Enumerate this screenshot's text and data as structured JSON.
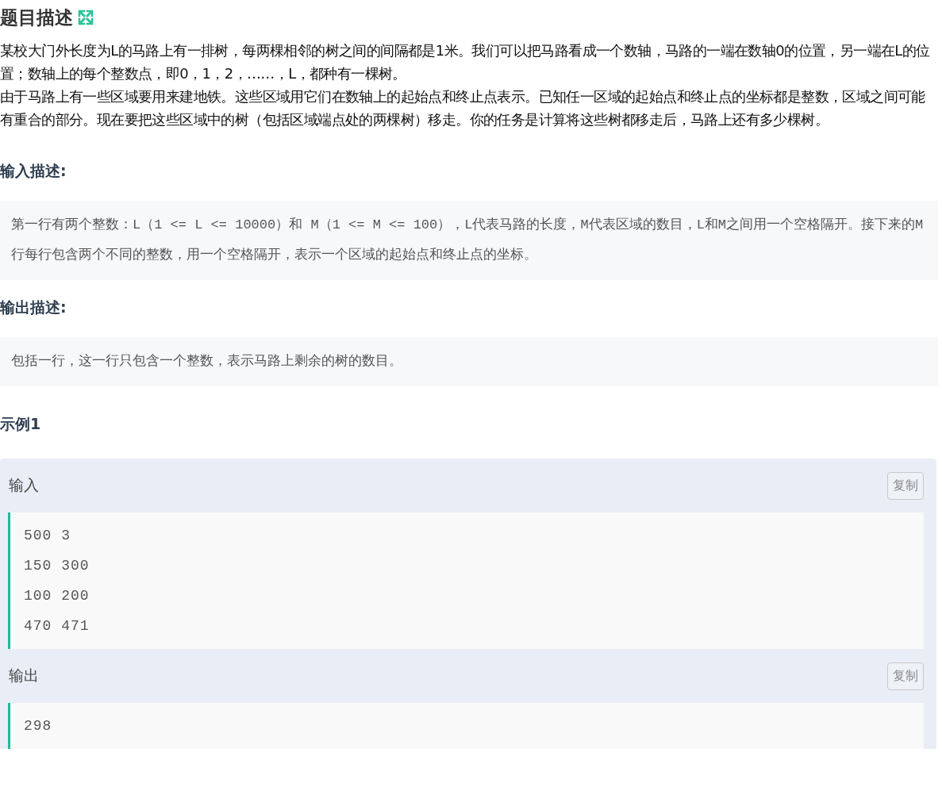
{
  "title": "题目描述",
  "description": [
    "某校大门外长度为L的马路上有一排树，每两棵相邻的树之间的间隔都是1米。我们可以把马路看成一个数轴，马路的一端在数轴0的位置，另一端在L的位置；数轴上的每个整数点，即0，1，2，……，L，都种有一棵树。",
    "由于马路上有一些区域要用来建地铁。这些区域用它们在数轴上的起始点和终止点表示。已知任一区域的起始点和终止点的坐标都是整数，区域之间可能有重合的部分。现在要把这些区域中的树（包括区域端点处的两棵树）移走。你的任务是计算将这些树都移走后，马路上还有多少棵树。"
  ],
  "input_section": {
    "heading": "输入描述:",
    "text": "第一行有两个整数：L（1 <= L <= 10000）和 M（1 <= M <= 100），L代表马路的长度，M代表区域的数目，L和M之间用一个空格隔开。接下来的M行每行包含两个不同的整数，用一个空格隔开，表示一个区域的起始点和终止点的坐标。"
  },
  "output_section": {
    "heading": "输出描述:",
    "text": "包括一行，这一行只包含一个整数，表示马路上剩余的树的数目。"
  },
  "example": {
    "heading": "示例1",
    "blocks": [
      {
        "label": "输入",
        "copy_button": "复制",
        "lines": [
          "500 3",
          "150 300",
          "100 200",
          "470 471"
        ]
      },
      {
        "label": "输出",
        "copy_button": "复制",
        "lines": [
          "298"
        ]
      }
    ]
  }
}
